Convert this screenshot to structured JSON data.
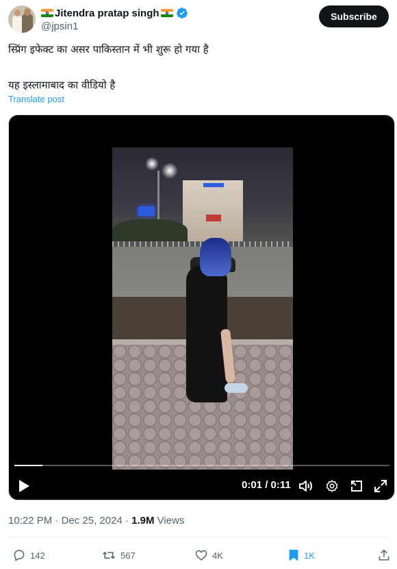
{
  "author": {
    "display_name": "Jitendra pratap singh",
    "handle": "@jpsin1",
    "flag_icon": "india-flag-icon",
    "verified_color": "#1d9bf0"
  },
  "subscribe_label": "Subscribe",
  "tweet": {
    "line1": "स्प्रिंग इफेक्ट का असर  पाकिस्तान में भी शुरू हो गया है",
    "line2": "यह इस्लामाबाद का वीडियो है",
    "translate_label": "Translate post"
  },
  "video": {
    "time": "0:01 / 0:11",
    "progress_fraction": 0.075
  },
  "meta": {
    "time": "10:22 PM",
    "separator": "·",
    "date": "Dec 25, 2024",
    "views_count": "1.9M",
    "views_label": "Views"
  },
  "actions": {
    "replies": "142",
    "reposts": "567",
    "likes": "4K",
    "bookmarks": "1K"
  },
  "colors": {
    "accent": "#1d9bf0",
    "text": "#0f1419",
    "muted": "#536471"
  }
}
